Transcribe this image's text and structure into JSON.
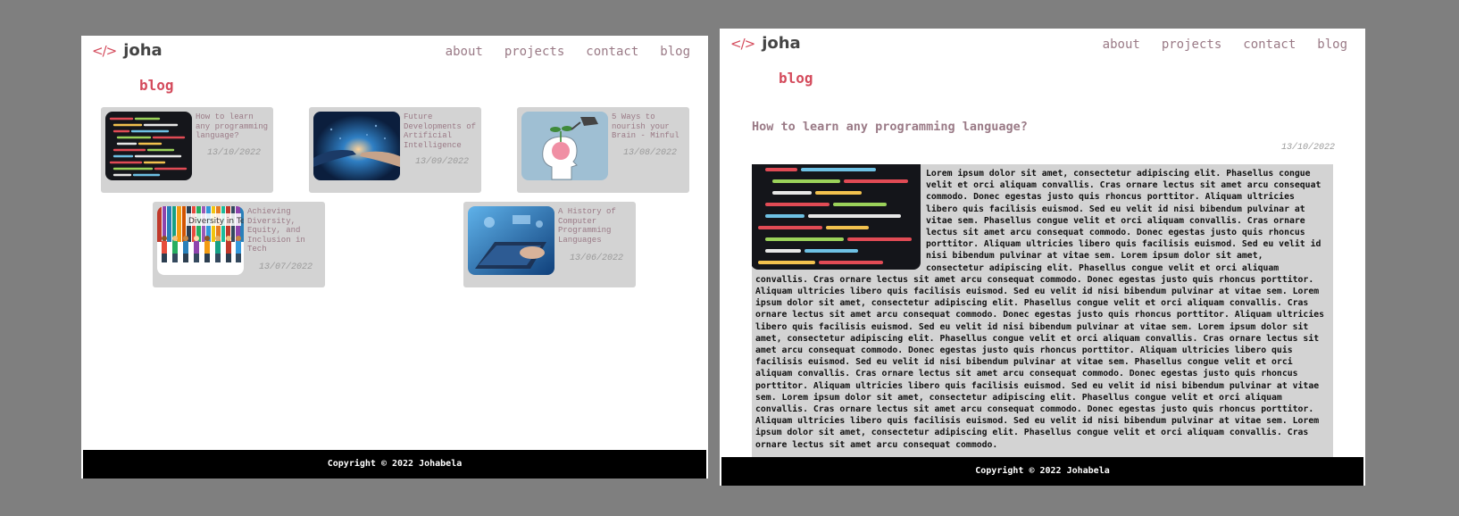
{
  "logo": {
    "code": "</>",
    "name": "joha"
  },
  "nav": [
    "about",
    "projects",
    "contact",
    "blog"
  ],
  "blog_heading": "blog",
  "cards": [
    {
      "title": "How to learn any programming language?",
      "date": "13/10/2022",
      "image": "code-screen-icon"
    },
    {
      "title": "Future Developments of Artificial Intelligence",
      "date": "13/09/2022",
      "image": "ai-hand-icon"
    },
    {
      "title": "5 Ways to nourish your Brain - Minful",
      "date": "13/08/2022",
      "image": "brain-plant-icon"
    },
    {
      "title": "Achieving Diversity, Equity, and Inclusion in Tech",
      "date": "13/07/2022",
      "image": "diversity-banner-icon",
      "image_caption": "Diversity in Tech"
    },
    {
      "title": "A History of Computer Programming Languages",
      "date": "13/06/2022",
      "image": "laptop-hands-icon"
    }
  ],
  "post": {
    "title": "How to learn any programming language?",
    "date": "13/10/2022",
    "body": "Lorem ipsum dolor sit amet, consectetur adipiscing elit. Phasellus congue velit et orci aliquam convallis. Cras ornare lectus sit amet arcu consequat commodo. Donec egestas justo quis rhoncus porttitor. Aliquam ultricies libero quis facilisis euismod. Sed eu velit id nisi bibendum pulvinar at vitae sem. Phasellus congue velit et orci aliquam convallis. Cras ornare lectus sit amet arcu consequat commodo. Donec egestas justo quis rhoncus porttitor. Aliquam ultricies libero quis facilisis euismod. Sed eu velit id nisi bibendum pulvinar at vitae sem. Lorem ipsum dolor sit amet, consectetur adipiscing elit. Phasellus congue velit et orci aliquam convallis. Cras ornare lectus sit amet arcu consequat commodo. Donec egestas justo quis rhoncus porttitor. Aliquam ultricies libero quis facilisis euismod. Sed eu velit id nisi bibendum pulvinar at vitae sem. Lorem ipsum dolor sit amet, consectetur adipiscing elit. Phasellus congue velit et orci aliquam convallis. Cras ornare lectus sit amet arcu consequat commodo. Donec egestas justo quis rhoncus porttitor. Aliquam ultricies libero quis facilisis euismod. Sed eu velit id nisi bibendum pulvinar at vitae sem. Lorem ipsum dolor sit amet, consectetur adipiscing elit. Phasellus congue velit et orci aliquam convallis. Cras ornare lectus sit amet arcu consequat commodo. Donec egestas justo quis rhoncus porttitor. Aliquam ultricies libero quis facilisis euismod. Sed eu velit id nisi bibendum pulvinar at vitae sem. Phasellus congue velit et orci aliquam convallis. Cras ornare lectus sit amet arcu consequat commodo. Donec egestas justo quis rhoncus porttitor. Aliquam ultricies libero quis facilisis euismod. Sed eu velit id nisi bibendum pulvinar at vitae sem. Lorem ipsum dolor sit amet, consectetur adipiscing elit. Phasellus congue velit et orci aliquam convallis. Cras ornare lectus sit amet arcu consequat commodo. Donec egestas justo quis rhoncus porttitor. Aliquam ultricies libero quis facilisis euismod. Sed eu velit id nisi bibendum pulvinar at vitae sem. Lorem ipsum dolor sit amet, consectetur adipiscing elit. Phasellus congue velit et orci aliquam convallis. Cras ornare lectus sit amet arcu consequat commodo."
  },
  "footer": "Copyright © 2022 Johabela",
  "colors": {
    "accent": "#d44b5c",
    "muted_text": "#9a7a86",
    "card_bg": "#d3d3d3",
    "footer_bg": "#000000"
  }
}
